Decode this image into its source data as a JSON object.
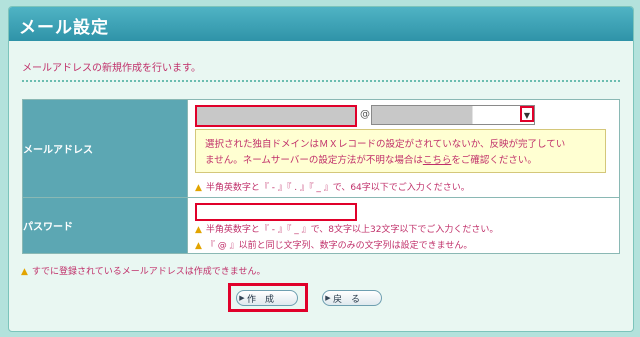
{
  "title": "メール設定",
  "description": "メールアドレスの新規作成を行います。",
  "mail": {
    "label": "メールアドレス",
    "at": "@",
    "notice_line1": "選択された独自ドメインはＭＸレコードの設定がされていないか、反映が完了してい",
    "notice_line2_pre": "ません。ネームサーバーの設定方法が不明な場合は",
    "notice_link": "こちら",
    "notice_line2_post": "をご確認ください。",
    "hint": "半角英数字と『 - 』『 . 』『 _ 』で、64字以下でご入力ください。"
  },
  "password": {
    "label": "パスワード",
    "hint1": "半角英数字と『 - 』『 _ 』で、8文字以上32文字以下でご入力ください。",
    "hint2": "『 @ 』以前と同じ文字列、数字のみの文字列は設定できません。"
  },
  "bottom_warning": "すでに登録されているメールアドレスは作成できません。",
  "buttons": {
    "create": "作　成",
    "back": "戻　る"
  },
  "icons": {
    "warning": "warning-icon",
    "dropdown": "chevron-down-icon",
    "arrow": "arrow-right-icon"
  }
}
